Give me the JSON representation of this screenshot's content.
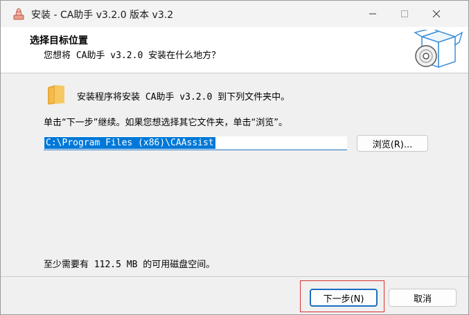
{
  "window": {
    "title": "安装 - CA助手 v3.2.0 版本 v3.2",
    "controls": {
      "minimize": "minimize",
      "maximize": "maximize",
      "close": "close"
    }
  },
  "header": {
    "title": "选择目标位置",
    "subtitle": "您想将 CA助手 v3.2.0 安装在什么地方？"
  },
  "main": {
    "intro": "安装程序将安装 CA助手 v3.2.0 到下列文件夹中。",
    "instruction": "单击“下一步”继续。如果您想选择其它文件夹，单击“浏览”。",
    "path_value": "C:\\Program Files (x86)\\CAAssist",
    "browse_label": "浏览(R)...",
    "space_required": "至少需要有 112.5 MB 的可用磁盘空间。"
  },
  "footer": {
    "next_label": "下一步(N)",
    "cancel_label": "取消"
  },
  "colors": {
    "accent": "#0078d7",
    "highlight_box": "#d9302c"
  }
}
